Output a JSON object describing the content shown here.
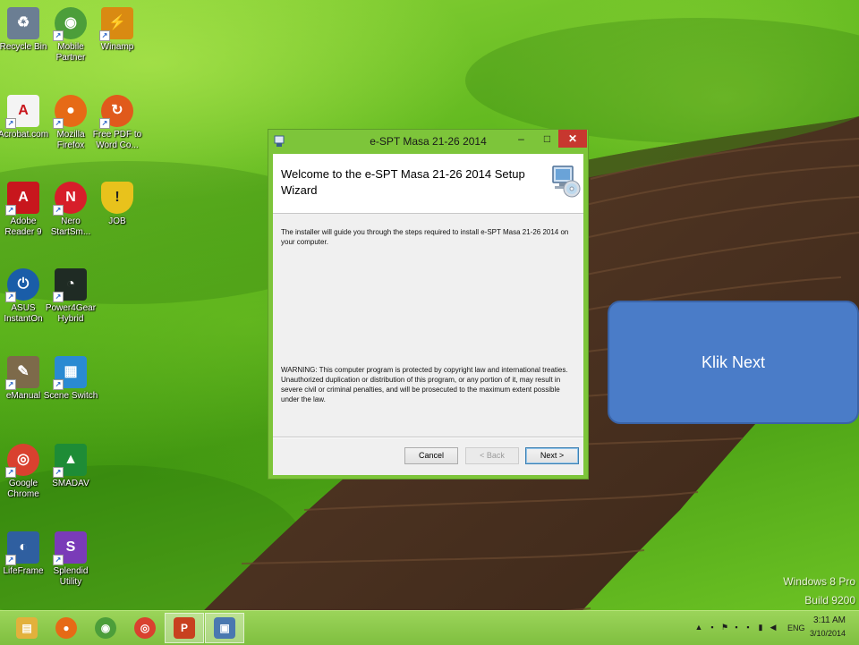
{
  "desktop_icons": [
    {
      "label": "Recycle Bin",
      "icon": "recycle-bin-icon",
      "color": "#6b7e93"
    },
    {
      "label": "Mobile Partner",
      "icon": "mobile-partner-icon",
      "color": "#4c9e3a"
    },
    {
      "label": "Winamp",
      "icon": "winamp-icon",
      "color": "#d98a12"
    },
    {
      "label": "Acrobat.com",
      "icon": "acrobat-com-icon",
      "color": "#f4f4f4"
    },
    {
      "label": "Mozilla Firefox",
      "icon": "firefox-icon",
      "color": "#e66a16"
    },
    {
      "label": "Free PDF to Word Co...",
      "icon": "pdf-to-word-icon",
      "color": "#e05a1c"
    },
    {
      "label": "Adobe Reader 9",
      "icon": "adobe-reader-icon",
      "color": "#c8161d"
    },
    {
      "label": "Nero StartSm...",
      "icon": "nero-icon",
      "color": "#d71e2a"
    },
    {
      "label": "JOB",
      "icon": "shield-icon",
      "color": "#e8c21c"
    },
    {
      "label": "ASUS InstantOn",
      "icon": "asus-instanton-icon",
      "color": "#1a5da8"
    },
    {
      "label": "Power4Gear Hybrid",
      "icon": "power4gear-icon",
      "color": "#1f2b24"
    },
    {
      "label": "eManual",
      "icon": "emanual-icon",
      "color": "#7d6a4a"
    },
    {
      "label": "Scene Switch",
      "icon": "scene-switch-icon",
      "color": "#2a8ad2"
    },
    {
      "label": "Google Chrome",
      "icon": "chrome-icon",
      "color": "#d9412f"
    },
    {
      "label": "SMADAV",
      "icon": "smadav-icon",
      "color": "#1e8c36"
    },
    {
      "label": "LifeFrame",
      "icon": "lifeframe-icon",
      "color": "#2f5fa0"
    },
    {
      "label": "Splendid Utility",
      "icon": "splendid-icon",
      "color": "#7a3bb8"
    }
  ],
  "watermark": {
    "line1": "Windows 8 Pro",
    "line2": "Build 9200"
  },
  "dialog": {
    "window_title": "e-SPT Masa 21-26 2014",
    "minimize_glyph": "–",
    "maximize_glyph": "□",
    "close_glyph": "✕",
    "heading": "Welcome to the e-SPT Masa 21-26 2014 Setup Wizard",
    "intro": "The installer will guide you through the steps required to install e-SPT Masa 21-26 2014 on your computer.",
    "warning": "WARNING: This computer program is protected by copyright law and international treaties. Unauthorized duplication or distribution of this program, or any portion of it, may result in severe civil or criminal penalties, and will be prosecuted to the maximum extent possible under the law.",
    "buttons": {
      "cancel": "Cancel",
      "back": "< Back",
      "next": "Next >"
    }
  },
  "callout": {
    "text": "Klik Next",
    "color": "#4a7cc8"
  },
  "taskbar": {
    "items": [
      {
        "name": "file-explorer",
        "icon": "folder-icon",
        "glyph": "▤",
        "color": "#e2b13c"
      },
      {
        "name": "firefox",
        "icon": "firefox-icon",
        "glyph": "●",
        "color": "#e66a16"
      },
      {
        "name": "mobile-partner",
        "icon": "mobile-partner-icon",
        "glyph": "◉",
        "color": "#4c9e3a"
      },
      {
        "name": "chrome",
        "icon": "chrome-icon",
        "glyph": "◎",
        "color": "#d9412f"
      },
      {
        "name": "powerpoint",
        "icon": "powerpoint-icon",
        "glyph": "P",
        "color": "#c8401f"
      },
      {
        "name": "setup-installer",
        "icon": "installer-icon",
        "glyph": "▣",
        "color": "#4a78b0"
      }
    ],
    "tray": {
      "language": "ENG",
      "time": "3:11 AM",
      "date": "3/10/2014"
    }
  }
}
